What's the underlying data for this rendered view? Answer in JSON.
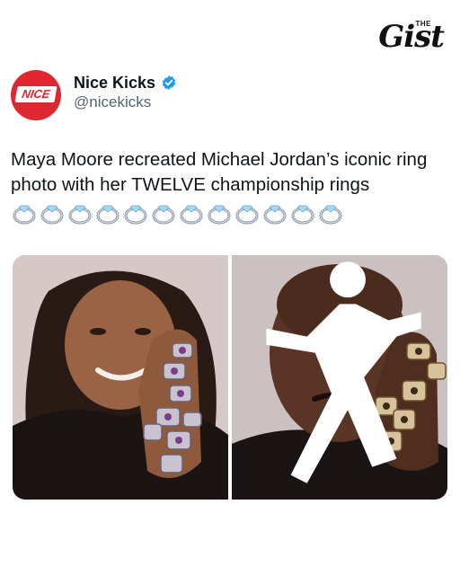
{
  "brand": {
    "small": "THE",
    "word": "Gist"
  },
  "tweet": {
    "author": {
      "display_name": "Nice Kicks",
      "handle": "@nicekicks",
      "avatar_text": "NICE",
      "verified": true
    },
    "text": "Maya Moore recreated Michael Jordan’s iconic ring photo with her TWELVE championship rings",
    "ring_emoji_count": 12,
    "media": [
      {
        "name": "maya-moore-photo"
      },
      {
        "name": "michael-jordan-photo"
      }
    ]
  },
  "colors": {
    "brand_red": "#e0262f",
    "verified_blue": "#1d9bf0",
    "handle_gray": "#536471",
    "text": "#0f1419"
  },
  "icons": {
    "verified": "verified-badge-icon",
    "ring": "ring-emoji-icon",
    "jumpman": "jumpman-logo-icon"
  }
}
